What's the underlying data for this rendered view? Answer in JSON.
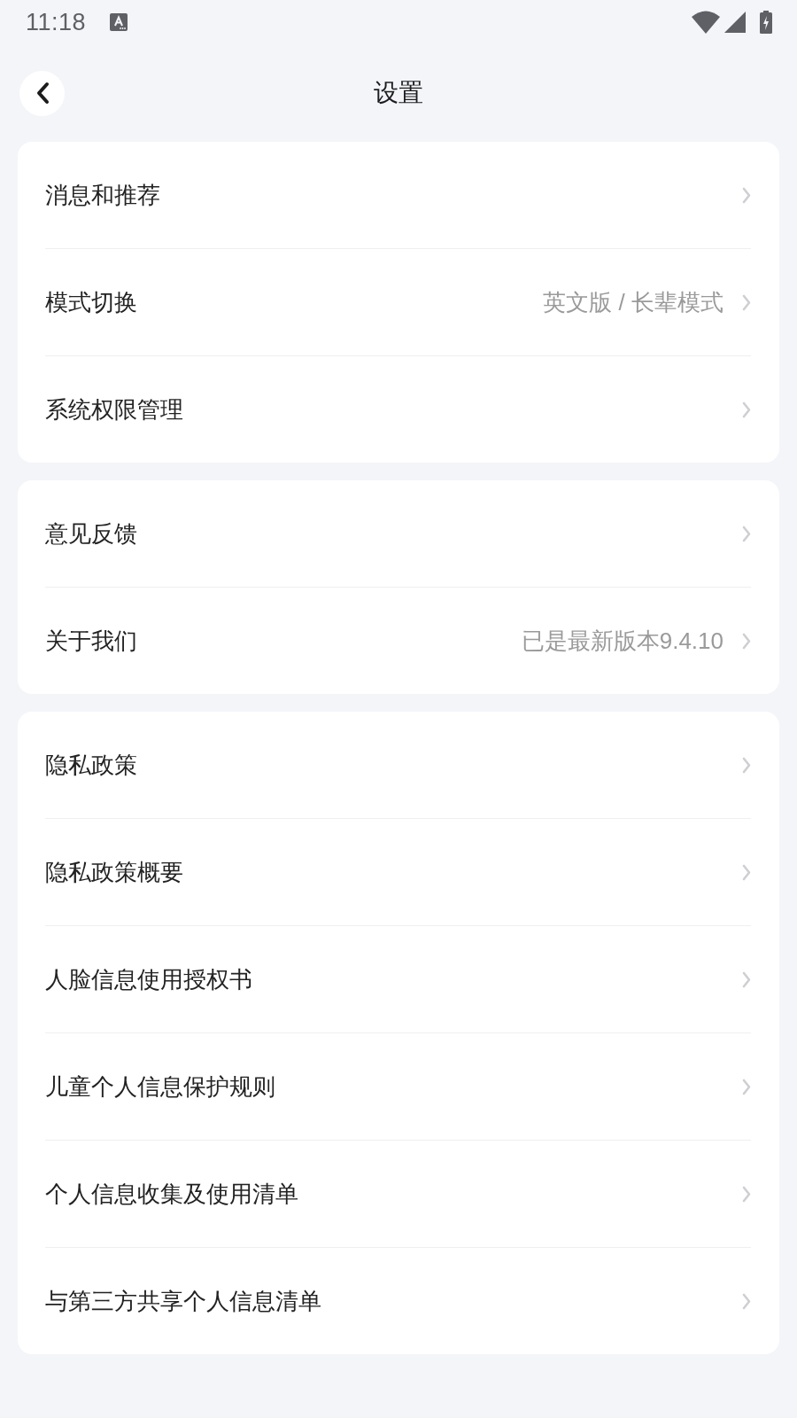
{
  "status_bar": {
    "time": "11:18"
  },
  "header": {
    "title": "设置"
  },
  "groups": [
    {
      "items": [
        {
          "label": "消息和推荐"
        },
        {
          "label": "模式切换",
          "value": "英文版 / 长辈模式"
        },
        {
          "label": "系统权限管理"
        }
      ]
    },
    {
      "items": [
        {
          "label": "意见反馈"
        },
        {
          "label": "关于我们",
          "value": "已是最新版本9.4.10"
        }
      ]
    },
    {
      "items": [
        {
          "label": "隐私政策"
        },
        {
          "label": "隐私政策概要"
        },
        {
          "label": "人脸信息使用授权书"
        },
        {
          "label": "儿童个人信息保护规则"
        },
        {
          "label": "个人信息收集及使用清单"
        },
        {
          "label": "与第三方共享个人信息清单"
        }
      ]
    }
  ]
}
